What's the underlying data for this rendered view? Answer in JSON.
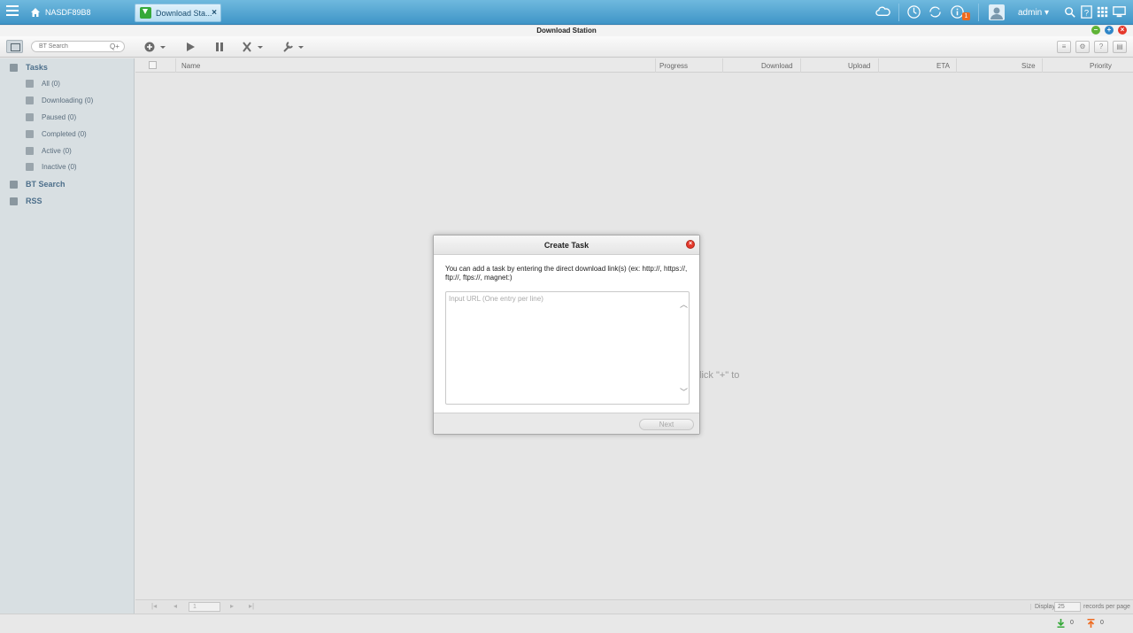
{
  "topbar": {
    "nas_name": "NASDF89B8",
    "app_tab_label": "Download Sta...",
    "app_tab_close": "×",
    "user": "admin",
    "notification_count": "1"
  },
  "window": {
    "title": "Download Station",
    "controls": {
      "minimize": "–",
      "maximize": "+",
      "close": "×"
    }
  },
  "toolbar": {
    "search_placeholder": "BT Search",
    "search_icon": "Q+",
    "add_icon": "plus-circle-icon",
    "start_icon": "play-icon",
    "pause_icon": "pause-icon",
    "remove_icon": "x-icon",
    "settings_icon": "wrench-icon",
    "right_buttons": [
      "list-add-icon",
      "gear-icon",
      "help-icon",
      "layout-icon"
    ]
  },
  "sidebar": {
    "tasks_label": "Tasks",
    "items": [
      {
        "label": "All (0)",
        "icon": "people-icon"
      },
      {
        "label": "Downloading (0)",
        "icon": "download-icon"
      },
      {
        "label": "Paused (0)",
        "icon": "pause-icon"
      },
      {
        "label": "Completed (0)",
        "icon": "check-icon"
      },
      {
        "label": "Active (0)",
        "icon": "bolt-icon"
      },
      {
        "label": "Inactive (0)",
        "icon": "lock-icon"
      }
    ],
    "bt_search_label": "BT Search",
    "rss_label": "RSS"
  },
  "table": {
    "columns": [
      "Name",
      "Progress",
      "Download",
      "Upload",
      "ETA",
      "Size",
      "Priority"
    ],
    "hint_fragment": "lick \"+\" to"
  },
  "pager": {
    "page_value": "1",
    "display_label": "Display",
    "per_page_value": "25",
    "records_label": "records per page"
  },
  "status": {
    "download_count": "0",
    "upload_count": "0"
  },
  "modal": {
    "title": "Create Task",
    "description": "You can add a task by entering the direct download link(s) (ex: http://, https://, ftp://, ftps://, magnet:)",
    "url_placeholder": "Input URL (One entry per line)",
    "url_value": "",
    "next_label": "Next"
  },
  "colors": {
    "topbar": "#3f95c7",
    "sidebar": "#d8dfe2",
    "close_red": "#e5382b",
    "download_green": "#36a93a",
    "upload_orange": "#ee6a1f"
  }
}
